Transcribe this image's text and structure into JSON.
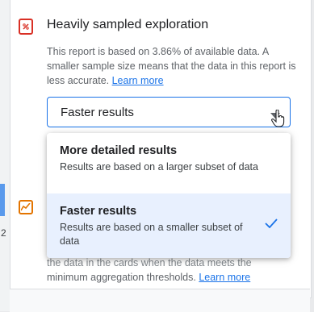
{
  "card": {
    "title": "Heavily sampled exploration",
    "description": "This report is based on 3.86% of available data. A smaller sample size means that the data in this report is less accurate.",
    "learn_more": "Learn more",
    "warning_icon": "sampling-warning-icon",
    "accent_color": "#1a73e8",
    "warning_color": "#d93025"
  },
  "select": {
    "value": "Faster results",
    "caret_icon": "caret-down-icon"
  },
  "dropdown": {
    "options": [
      {
        "label": "More detailed results",
        "description": "Results are based on a larger subset of data",
        "selected": false
      },
      {
        "label": "Faster results",
        "description": "Results are based on a smaller subset of data",
        "selected": true
      }
    ],
    "selected_bg": "#e8f0fe"
  },
  "second_card": {
    "icon": "chart-icon",
    "icon_color": "#e37400",
    "partial_text_hidden": "the data in the cards when the data meets the",
    "partial_text": "minimum aggregation thresholds.",
    "learn_more": "Learn more"
  },
  "background": {
    "left_digit": "2"
  }
}
